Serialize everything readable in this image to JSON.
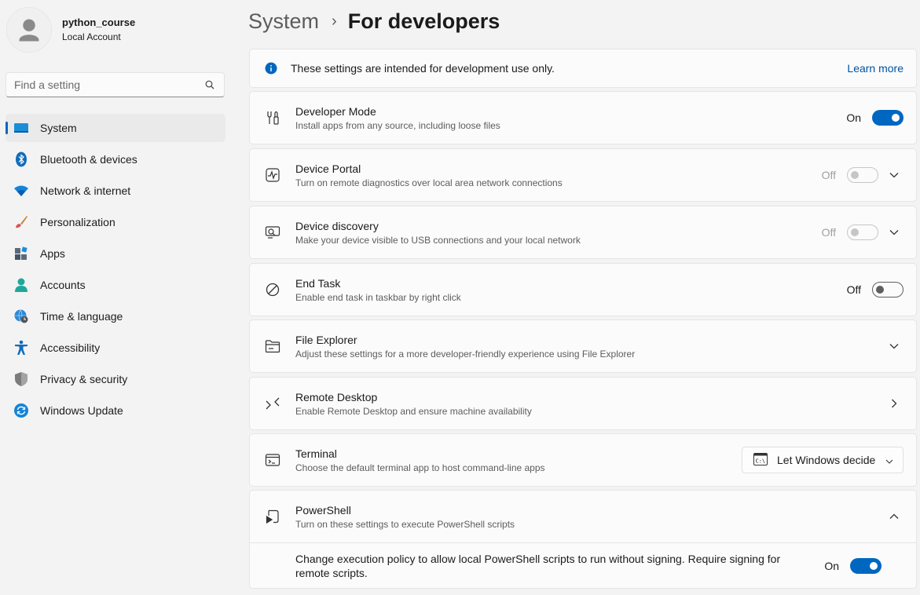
{
  "user": {
    "name": "python_course",
    "account_type": "Local Account"
  },
  "search": {
    "placeholder": "Find a setting"
  },
  "nav": [
    {
      "label": "System",
      "icon": "system-icon"
    },
    {
      "label": "Bluetooth & devices",
      "icon": "bluetooth-icon"
    },
    {
      "label": "Network & internet",
      "icon": "wifi-icon"
    },
    {
      "label": "Personalization",
      "icon": "brush-icon"
    },
    {
      "label": "Apps",
      "icon": "apps-icon"
    },
    {
      "label": "Accounts",
      "icon": "accounts-icon"
    },
    {
      "label": "Time & language",
      "icon": "globe-clock-icon"
    },
    {
      "label": "Accessibility",
      "icon": "accessibility-icon"
    },
    {
      "label": "Privacy & security",
      "icon": "shield-icon"
    },
    {
      "label": "Windows Update",
      "icon": "update-icon"
    }
  ],
  "breadcrumb": {
    "parent": "System",
    "separator": "›",
    "current": "For developers"
  },
  "info": {
    "text": "These settings are intended for development use only.",
    "link": "Learn more"
  },
  "settings": {
    "developer_mode": {
      "title": "Developer Mode",
      "subtitle": "Install apps from any source, including loose files",
      "state": "On"
    },
    "device_portal": {
      "title": "Device Portal",
      "subtitle": "Turn on remote diagnostics over local area network connections",
      "state": "Off"
    },
    "device_discovery": {
      "title": "Device discovery",
      "subtitle": "Make your device visible to USB connections and your local network",
      "state": "Off"
    },
    "end_task": {
      "title": "End Task",
      "subtitle": "Enable end task in taskbar by right click",
      "state": "Off"
    },
    "file_explorer": {
      "title": "File Explorer",
      "subtitle": "Adjust these settings for a more developer-friendly experience using File Explorer"
    },
    "remote_desktop": {
      "title": "Remote Desktop",
      "subtitle": "Enable Remote Desktop and ensure machine availability"
    },
    "terminal": {
      "title": "Terminal",
      "subtitle": "Choose the default terminal app to host command-line apps",
      "selected": "Let Windows decide"
    },
    "powershell": {
      "title": "PowerShell",
      "subtitle": "Turn on these settings to execute PowerShell scripts",
      "policy_text": "Change execution policy to allow local PowerShell scripts to run without signing. Require signing for remote scripts.",
      "policy_state": "On"
    }
  },
  "colors": {
    "accent": "#0067c0",
    "background": "#f3f3f3",
    "card": "#fbfbfb"
  }
}
